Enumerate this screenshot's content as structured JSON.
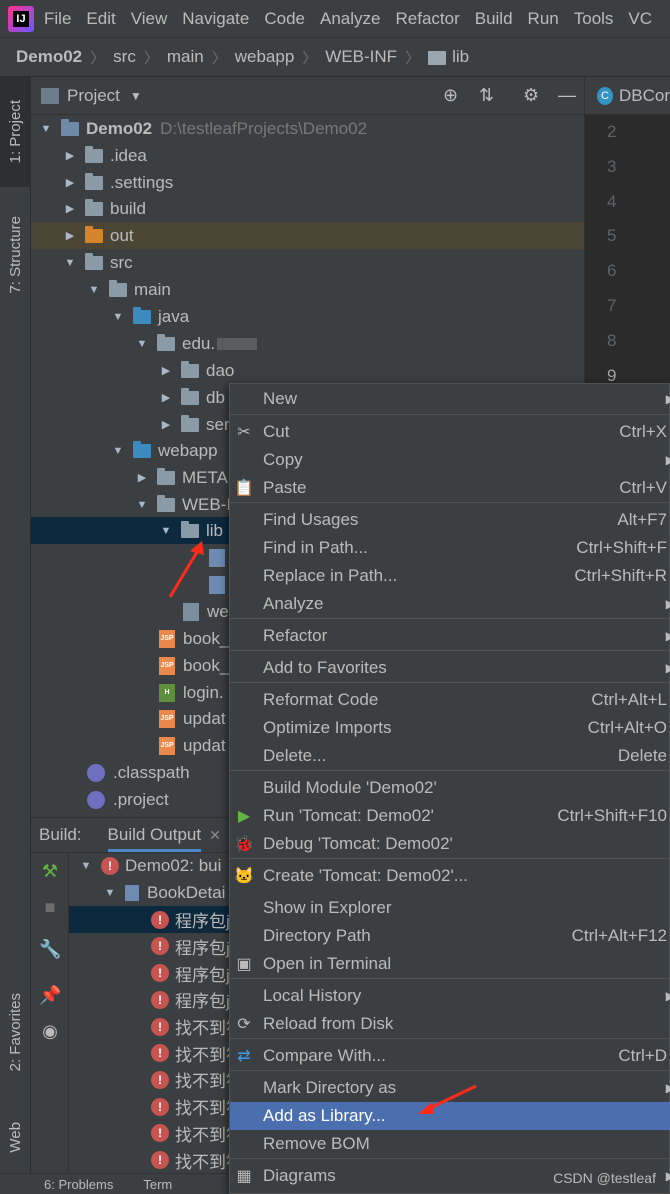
{
  "menubar": {
    "items": [
      "File",
      "Edit",
      "View",
      "Navigate",
      "Code",
      "Analyze",
      "Refactor",
      "Build",
      "Run",
      "Tools",
      "VC"
    ]
  },
  "navbar": {
    "crumbs": [
      "Demo02",
      "src",
      "main",
      "webapp",
      "WEB-INF",
      "lib"
    ]
  },
  "left_tabs": {
    "project": "1: Project",
    "structure": "7: Structure",
    "favorites": "2: Favorites",
    "web": "Web"
  },
  "project_panel": {
    "title": "Project"
  },
  "tree": [
    {
      "label": "Demo02",
      "path": "D:\\testleafProjects\\Demo02"
    },
    {
      "label": ".idea"
    },
    {
      "label": ".settings"
    },
    {
      "label": "build"
    },
    {
      "label": "out"
    },
    {
      "label": "src"
    },
    {
      "label": "main"
    },
    {
      "label": "java"
    },
    {
      "label": "edu."
    },
    {
      "label": "dao"
    },
    {
      "label": "db"
    },
    {
      "label": "ser"
    },
    {
      "label": "webapp"
    },
    {
      "label": "META"
    },
    {
      "label": "WEB-I"
    },
    {
      "label": "lib"
    },
    {
      "label": ""
    },
    {
      "label": ""
    },
    {
      "label": "we"
    },
    {
      "label": "book_"
    },
    {
      "label": "book_"
    },
    {
      "label": "login."
    },
    {
      "label": "updat"
    },
    {
      "label": "updat"
    },
    {
      "label": ".classpath"
    },
    {
      "label": ".project"
    }
  ],
  "editor": {
    "tab": "DBCor",
    "line_numbers": [
      "2",
      "3",
      "4",
      "5",
      "6",
      "7",
      "8",
      "9"
    ]
  },
  "build_panel": {
    "label": "Build:",
    "tab": "Build Output",
    "rows": [
      {
        "text": "Demo02: bui"
      },
      {
        "text": "BookDetai"
      },
      {
        "text": "程序包j"
      },
      {
        "text": "程序包j"
      },
      {
        "text": "程序包j"
      },
      {
        "text": "程序包j"
      },
      {
        "text": "找不到符"
      },
      {
        "text": "找不到符"
      },
      {
        "text": "找不到符"
      },
      {
        "text": "找不到符"
      },
      {
        "text": "找不到符"
      },
      {
        "text": "找不到符"
      }
    ]
  },
  "statusbar": {
    "problems": "6: Problems",
    "terminal": "Term"
  },
  "context_menu": {
    "items": [
      {
        "label": "New",
        "shortcut": "",
        "submenu": true,
        "icon": ""
      },
      {
        "label": "Cut",
        "shortcut": "Ctrl+X",
        "submenu": false,
        "icon": "✂"
      },
      {
        "label": "Copy",
        "shortcut": "",
        "submenu": true,
        "icon": ""
      },
      {
        "label": "Paste",
        "shortcut": "Ctrl+V",
        "submenu": false,
        "icon": "📋"
      },
      {
        "label": "Find Usages",
        "shortcut": "Alt+F7",
        "submenu": false,
        "icon": ""
      },
      {
        "label": "Find in Path...",
        "shortcut": "Ctrl+Shift+F",
        "submenu": false,
        "icon": ""
      },
      {
        "label": "Replace in Path...",
        "shortcut": "Ctrl+Shift+R",
        "submenu": false,
        "icon": ""
      },
      {
        "label": "Analyze",
        "shortcut": "",
        "submenu": true,
        "icon": ""
      },
      {
        "label": "Refactor",
        "shortcut": "",
        "submenu": true,
        "icon": ""
      },
      {
        "label": "Add to Favorites",
        "shortcut": "",
        "submenu": true,
        "icon": ""
      },
      {
        "label": "Reformat Code",
        "shortcut": "Ctrl+Alt+L",
        "submenu": false,
        "icon": ""
      },
      {
        "label": "Optimize Imports",
        "shortcut": "Ctrl+Alt+O",
        "submenu": false,
        "icon": ""
      },
      {
        "label": "Delete...",
        "shortcut": "Delete",
        "submenu": false,
        "icon": ""
      },
      {
        "label": "Build Module 'Demo02'",
        "shortcut": "",
        "submenu": false,
        "icon": ""
      },
      {
        "label": "Run 'Tomcat: Demo02'",
        "shortcut": "Ctrl+Shift+F10",
        "submenu": false,
        "icon": "▶"
      },
      {
        "label": "Debug 'Tomcat: Demo02'",
        "shortcut": "",
        "submenu": false,
        "icon": "🐞"
      },
      {
        "label": "Create 'Tomcat: Demo02'...",
        "shortcut": "",
        "submenu": false,
        "icon": "🐱"
      },
      {
        "label": "Show in Explorer",
        "shortcut": "",
        "submenu": false,
        "icon": ""
      },
      {
        "label": "Directory Path",
        "shortcut": "Ctrl+Alt+F12",
        "submenu": false,
        "icon": ""
      },
      {
        "label": "Open in Terminal",
        "shortcut": "",
        "submenu": false,
        "icon": "▣"
      },
      {
        "label": "Local History",
        "shortcut": "",
        "submenu": true,
        "icon": ""
      },
      {
        "label": "Reload from Disk",
        "shortcut": "",
        "submenu": false,
        "icon": "⟳"
      },
      {
        "label": "Compare With...",
        "shortcut": "Ctrl+D",
        "submenu": false,
        "icon": "⇄"
      },
      {
        "label": "Mark Directory as",
        "shortcut": "",
        "submenu": true,
        "icon": ""
      },
      {
        "label": "Add as Library...",
        "shortcut": "",
        "submenu": false,
        "icon": ""
      },
      {
        "label": "Remove BOM",
        "shortcut": "",
        "submenu": false,
        "icon": ""
      },
      {
        "label": "Diagrams",
        "shortcut": "",
        "submenu": true,
        "icon": "▦"
      }
    ]
  },
  "watermark": "CSDN @testleaf",
  "colors": {
    "highlight": "#4b6eaf",
    "selection": "#0d293e",
    "excluded": "#4b4535",
    "annotation_arrow": "#ff2a1a"
  }
}
